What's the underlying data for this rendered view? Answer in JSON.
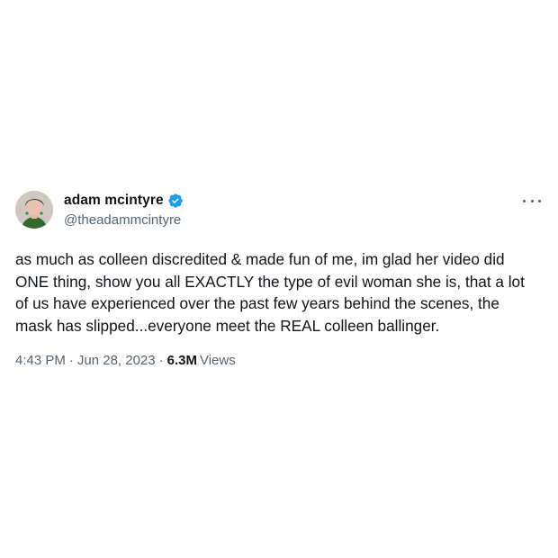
{
  "tweet": {
    "display_name": "adam mcintyre",
    "handle": "@theadammcintyre",
    "verified": true,
    "text": "as much as colleen discredited & made fun of me, im glad her video did\nONE thing, show you all EXACTLY the type of evil woman she is, that a lot\nof us have experienced over the past few years behind the scenes, the\nmask has slipped...everyone meet the REAL colleen ballinger.",
    "time": "4:43 PM",
    "date": "Jun 28, 2023",
    "separator": "·",
    "views_count": "6.3M",
    "views_label": "Views"
  },
  "colors": {
    "verified_badge": "#1d9bf0",
    "text_primary": "#0f1419",
    "text_secondary": "#536471"
  },
  "icons": {
    "verified": "verified-badge-icon",
    "more": "more-options-icon"
  }
}
